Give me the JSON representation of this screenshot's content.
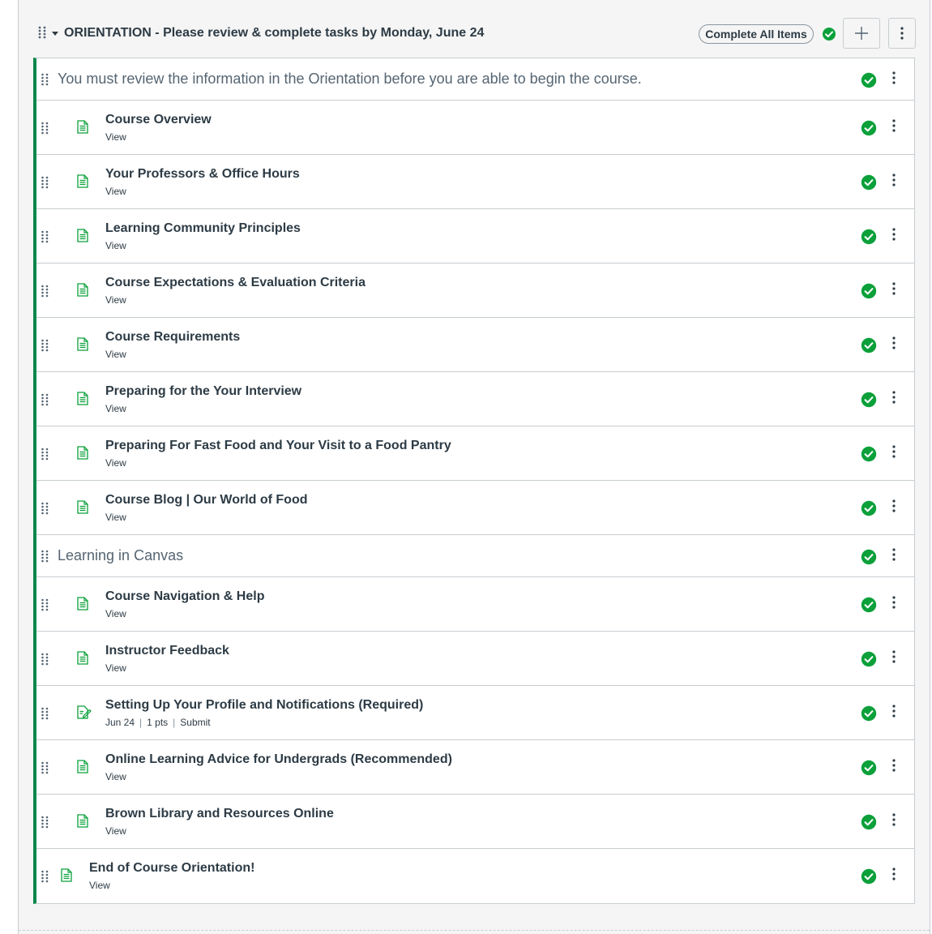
{
  "module": {
    "title": "ORIENTATION - Please review & complete tasks by Monday, June 24",
    "complete_all_label": "Complete All Items",
    "accent_color": "#0b874b",
    "success_color": "#0b874b"
  },
  "items": [
    {
      "kind": "header",
      "title": "You must review the information in the Orientation before you are able to begin the course."
    },
    {
      "kind": "page",
      "title": "Course Overview",
      "sub": "View"
    },
    {
      "kind": "page",
      "title": "Your Professors & Office Hours",
      "sub": "View"
    },
    {
      "kind": "page",
      "title": "Learning Community Principles",
      "sub": "View"
    },
    {
      "kind": "page",
      "title": "Course Expectations & Evaluation Criteria",
      "sub": "View"
    },
    {
      "kind": "page",
      "title": "Course Requirements",
      "sub": "View"
    },
    {
      "kind": "page",
      "title": "Preparing for the Your Interview",
      "sub": "View"
    },
    {
      "kind": "page",
      "title": "Preparing For Fast Food and Your Visit to a Food Pantry",
      "sub": "View"
    },
    {
      "kind": "page",
      "title": "Course Blog | Our World of Food",
      "sub": "View"
    },
    {
      "kind": "header",
      "title": "Learning in Canvas"
    },
    {
      "kind": "page",
      "title": "Course Navigation & Help",
      "sub": "View"
    },
    {
      "kind": "page",
      "title": "Instructor Feedback",
      "sub": "View"
    },
    {
      "kind": "assignment",
      "title": "Setting Up Your Profile and Notifications (Required)",
      "due": "Jun 24",
      "points": "1 pts",
      "action": "Submit"
    },
    {
      "kind": "page",
      "title": "Online Learning Advice for Undergrads (Recommended)",
      "sub": "View"
    },
    {
      "kind": "page",
      "title": "Brown Library and Resources Online",
      "sub": "View"
    },
    {
      "kind": "page-outdent",
      "title": "End of Course Orientation!",
      "sub": "View"
    }
  ],
  "icons": {
    "drag": "drag-handle-icon",
    "page": "document-icon",
    "assignment": "assignment-icon",
    "complete": "check-circle-icon",
    "menu": "kebab-menu-icon",
    "add": "plus-icon",
    "collapse": "caret-down-icon"
  }
}
